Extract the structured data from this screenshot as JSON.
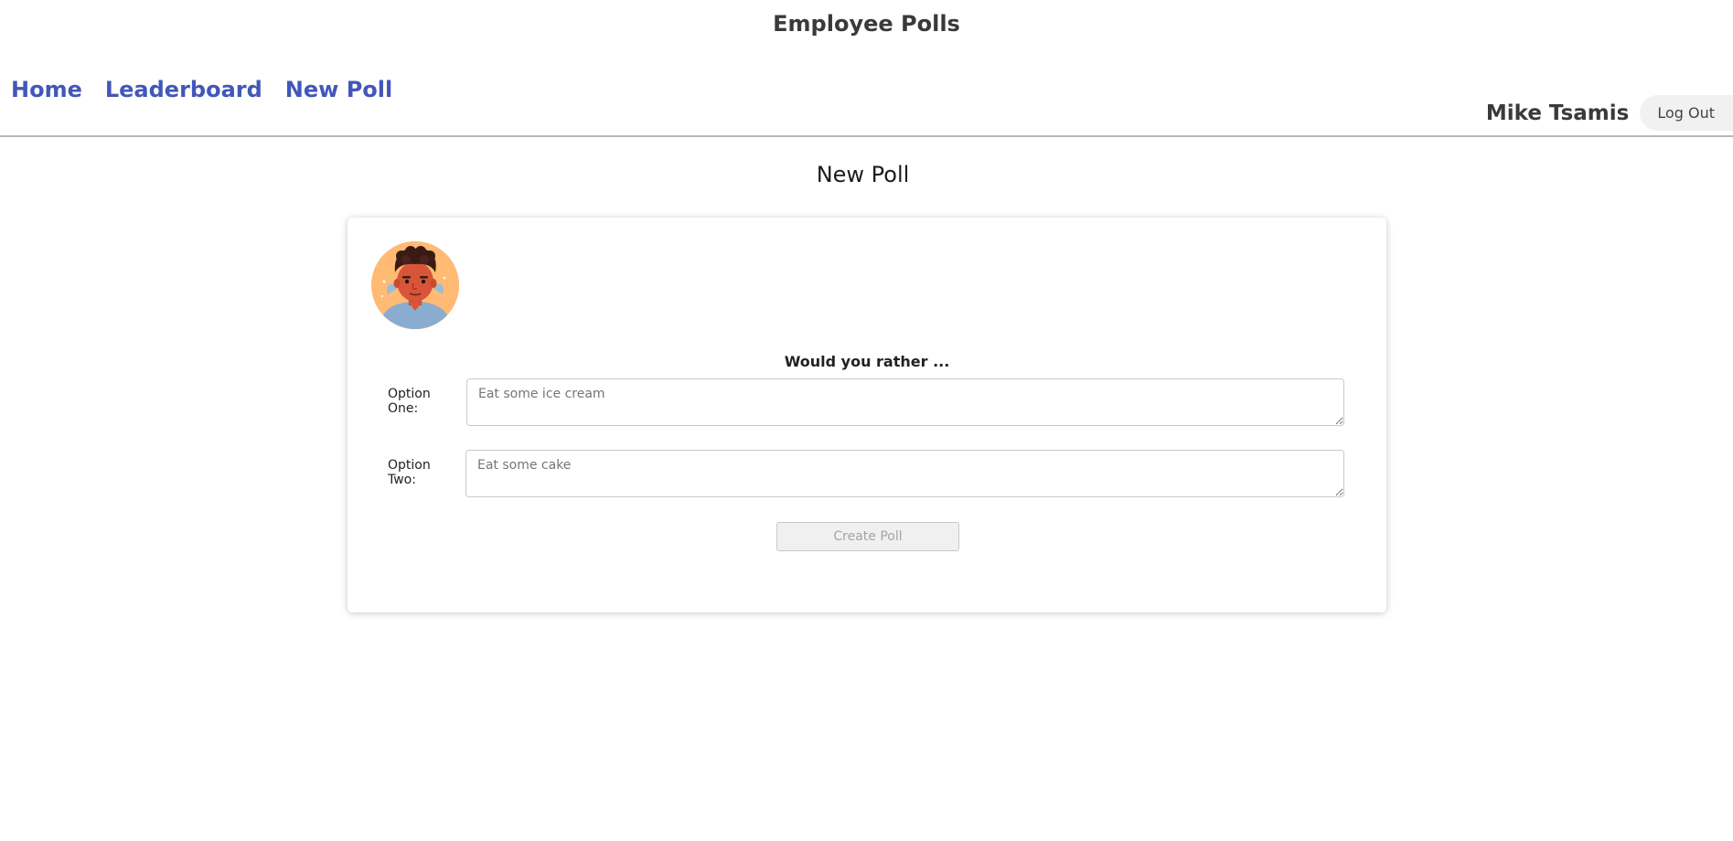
{
  "header": {
    "app_title": "Employee Polls"
  },
  "nav": {
    "items": [
      {
        "label": "Home"
      },
      {
        "label": "Leaderboard"
      },
      {
        "label": "New Poll"
      }
    ]
  },
  "user": {
    "name": "Mike Tsamis",
    "logout_label": "Log Out"
  },
  "main": {
    "heading": "New Poll",
    "prompt": "Would you rather ...",
    "option_one": {
      "label": "Option One:",
      "placeholder": "Eat some ice cream",
      "value": ""
    },
    "option_two": {
      "label": "Option Two:",
      "placeholder": "Eat some cake",
      "value": ""
    },
    "submit_label": "Create Poll"
  },
  "colors": {
    "nav_link": "#4257b8",
    "avatar_bg": "#ffbb73"
  }
}
